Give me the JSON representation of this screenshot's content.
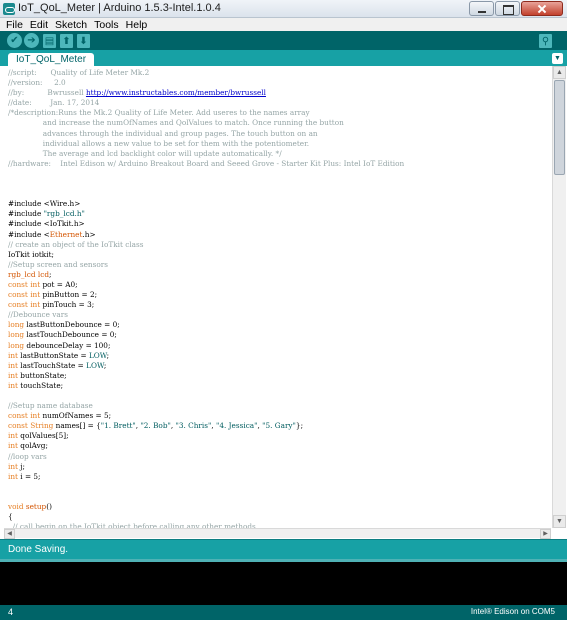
{
  "window": {
    "title": "IoT_QoL_Meter | Arduino 1.5.3-Intel.1.0.4",
    "app_icon": "arduino-icon"
  },
  "menu": [
    "File",
    "Edit",
    "Sketch",
    "Tools",
    "Help"
  ],
  "toolbar": {
    "buttons": [
      {
        "name": "verify",
        "icon": "checkmark-icon",
        "glyph": "✔"
      },
      {
        "name": "upload",
        "icon": "arrow-right-icon",
        "glyph": "➔"
      },
      {
        "name": "new",
        "icon": "new-file-icon",
        "glyph": "▤"
      },
      {
        "name": "open",
        "icon": "open-icon",
        "glyph": "⬆"
      },
      {
        "name": "save",
        "icon": "save-icon",
        "glyph": "⬇"
      }
    ],
    "serial_monitor": {
      "icon": "magnifier-icon",
      "glyph": "⚲"
    }
  },
  "tabs": [
    {
      "label": "IoT_QoL_Meter"
    }
  ],
  "tab_menu_glyph": "▼",
  "code_lines": [
    [
      [
        "c-comment",
        "//script:      Quality of Life Meter Mk.2"
      ]
    ],
    [
      [
        "c-comment",
        "//version:     2.0"
      ]
    ],
    [
      [
        "c-comment",
        "//by:          Bwrussell "
      ],
      [
        "c-link",
        "http://www.instructables.com/member/bwrussell"
      ]
    ],
    [
      [
        "c-comment",
        "//date:        Jan. 17, 2014"
      ]
    ],
    [
      [
        "c-comment",
        "/*description:Runs the Mk.2 Quality of Life Meter. Add useres to the names array"
      ]
    ],
    [
      [
        "c-comment",
        "               and increase the numOfNames and QolValues to match. Once running the button"
      ]
    ],
    [
      [
        "c-comment",
        "               advances through the individual and group pages. The touch button on an"
      ]
    ],
    [
      [
        "c-comment",
        "               individual allows a new value to be set for them with the potentiometer."
      ]
    ],
    [
      [
        "c-comment",
        "               The average and lcd backlight color will update automatically. */"
      ]
    ],
    [
      [
        "c-comment",
        "//hardware:    Intel Edison w/ Arduino Breakout Board and Seeed Grove - Starter Kit Plus: Intel IoT Edition"
      ]
    ],
    [],
    [],
    [],
    [
      [
        "c-ident",
        "#include <Wire.h>"
      ]
    ],
    [
      [
        "c-ident",
        "#include "
      ],
      [
        "c-string",
        "\"rgb_lcd.h\""
      ]
    ],
    [
      [
        "c-ident",
        "#include <IoTkit.h>"
      ]
    ],
    [
      [
        "c-ident",
        "#include <"
      ],
      [
        "c-lib",
        "Ethernet"
      ],
      [
        "c-ident",
        ".h>"
      ]
    ],
    [
      [
        "c-comment",
        "// create an object of the IoTkit class"
      ]
    ],
    [
      [
        "c-ident",
        "IoTkit iotkit;"
      ]
    ],
    [
      [
        "c-comment",
        "//Setup screen and sensors"
      ]
    ],
    [
      [
        "c-lib",
        "rgb_lcd"
      ],
      [
        "c-ident",
        " "
      ],
      [
        "c-lib",
        "lcd"
      ],
      [
        "c-ident",
        ";"
      ]
    ],
    [
      [
        "c-keyword",
        "const"
      ],
      [
        "c-ident",
        " "
      ],
      [
        "c-keyword",
        "int"
      ],
      [
        "c-ident",
        " pot = A0;"
      ]
    ],
    [
      [
        "c-keyword",
        "const"
      ],
      [
        "c-ident",
        " "
      ],
      [
        "c-keyword",
        "int"
      ],
      [
        "c-ident",
        " pinButton = 2;"
      ]
    ],
    [
      [
        "c-keyword",
        "const"
      ],
      [
        "c-ident",
        " "
      ],
      [
        "c-keyword",
        "int"
      ],
      [
        "c-ident",
        " pinTouch = 3;"
      ]
    ],
    [
      [
        "c-comment",
        "//Debounce vars"
      ]
    ],
    [
      [
        "c-keyword",
        "long"
      ],
      [
        "c-ident",
        " lastButtonDebounce = 0;"
      ]
    ],
    [
      [
        "c-keyword",
        "long"
      ],
      [
        "c-ident",
        " lastTouchDebounce = 0;"
      ]
    ],
    [
      [
        "c-keyword",
        "long"
      ],
      [
        "c-ident",
        " debounceDelay = 100;"
      ]
    ],
    [
      [
        "c-keyword",
        "int"
      ],
      [
        "c-ident",
        " lastButtonState = "
      ],
      [
        "c-string",
        "LOW"
      ],
      [
        "c-ident",
        ";"
      ]
    ],
    [
      [
        "c-keyword",
        "int"
      ],
      [
        "c-ident",
        " lastTouchState = "
      ],
      [
        "c-string",
        "LOW"
      ],
      [
        "c-ident",
        ";"
      ]
    ],
    [
      [
        "c-keyword",
        "int"
      ],
      [
        "c-ident",
        " buttonState;"
      ]
    ],
    [
      [
        "c-keyword",
        "int"
      ],
      [
        "c-ident",
        " touchState;"
      ]
    ],
    [],
    [
      [
        "c-comment",
        "//Setup name database"
      ]
    ],
    [
      [
        "c-keyword",
        "const"
      ],
      [
        "c-ident",
        " "
      ],
      [
        "c-keyword",
        "int"
      ],
      [
        "c-ident",
        " numOfNames = 5;"
      ]
    ],
    [
      [
        "c-keyword",
        "const"
      ],
      [
        "c-ident",
        " "
      ],
      [
        "c-keyword",
        "String"
      ],
      [
        "c-ident",
        " names[] = {"
      ],
      [
        "c-string",
        "\"1. Brett\""
      ],
      [
        "c-ident",
        ", "
      ],
      [
        "c-string",
        "\"2. Bob\""
      ],
      [
        "c-ident",
        ", "
      ],
      [
        "c-string",
        "\"3. Chris\""
      ],
      [
        "c-ident",
        ", "
      ],
      [
        "c-string",
        "\"4. Jessica\""
      ],
      [
        "c-ident",
        ", "
      ],
      [
        "c-string",
        "\"5. Gary\""
      ],
      [
        "c-ident",
        "};"
      ]
    ],
    [
      [
        "c-keyword",
        "int"
      ],
      [
        "c-ident",
        " qolValues[5];"
      ]
    ],
    [
      [
        "c-keyword",
        "int"
      ],
      [
        "c-ident",
        " qolAvg;"
      ]
    ],
    [
      [
        "c-comment",
        "//loop vars"
      ]
    ],
    [
      [
        "c-keyword",
        "int"
      ],
      [
        "c-ident",
        " j;"
      ]
    ],
    [
      [
        "c-keyword",
        "int"
      ],
      [
        "c-ident",
        " i = 5;"
      ]
    ],
    [],
    [],
    [
      [
        "c-keyword",
        "void"
      ],
      [
        "c-ident",
        " "
      ],
      [
        "c-func",
        "setup"
      ],
      [
        "c-ident",
        "()"
      ]
    ],
    [
      [
        "c-ident",
        "{"
      ]
    ],
    [
      [
        "c-comment",
        "  // call begin on the IoTkit object before calling any other methods"
      ]
    ]
  ],
  "status": {
    "text": "Done Saving."
  },
  "footer": {
    "line_number": "4",
    "board_info": "Intel® Edison on COM5"
  },
  "colors": {
    "toolbar": "#006468",
    "tabbar": "#17a1a5",
    "comment": "#95a5a6",
    "keyword": "#e67e22"
  }
}
